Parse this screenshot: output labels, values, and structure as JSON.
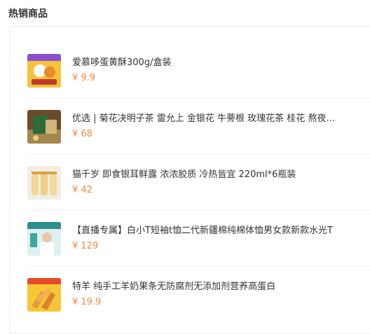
{
  "section": {
    "title": "热销商品"
  },
  "products": [
    {
      "name": "爱慕哆蛋黄酥300g/盒装",
      "price": "¥ 9.9"
    },
    {
      "name": "优选 | 菊花决明子茶 雷允上 金银花 牛蒡根 玫瑰花茶 桂花 熬夜…",
      "price": "¥ 68"
    },
    {
      "name": "猫千岁 即食银耳鲜露 浓浓胶质 冷热皆宜 220ml*6瓶装",
      "price": "¥ 42"
    },
    {
      "name": "【直播专属】白小T短袖t恤二代新疆棉纯棉体恤男女款新款水光T",
      "price": "¥ 129"
    },
    {
      "name": "特羊 纯手工羊奶果条无防腐剂无添加剂营养高蛋白",
      "price": "¥ 19.9"
    }
  ],
  "colors": {
    "price": "#f08a3a",
    "border": "#ececec"
  }
}
